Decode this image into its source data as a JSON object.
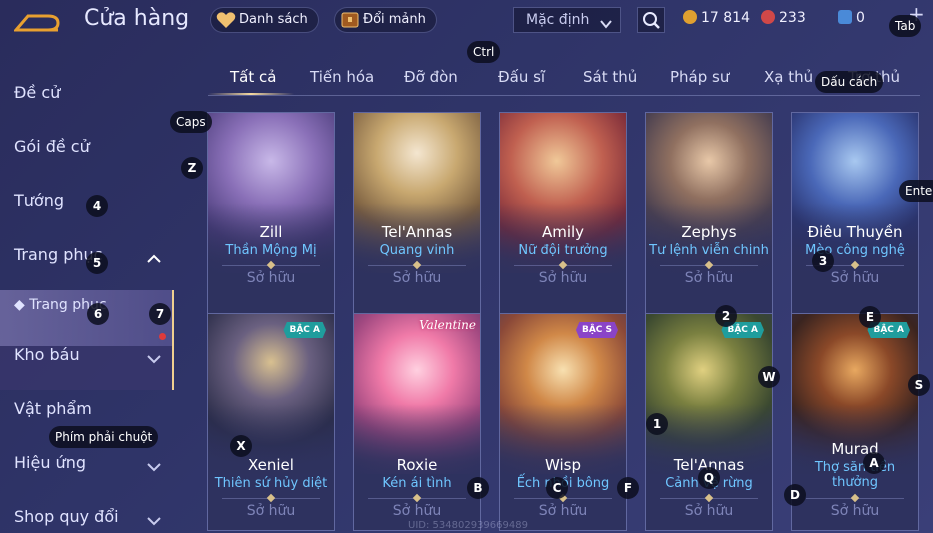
{
  "header": {
    "title": "Cửa hàng",
    "wishlist_label": "Danh sách",
    "exchange_label": "Đổi mảnh",
    "sort_value": "Mặc định",
    "currency_gold": "17 814",
    "currency_red": "233",
    "currency_voucher": "0",
    "plus_symbol": "+"
  },
  "tabs": [
    {
      "label": "Tất cả",
      "active": true
    },
    {
      "label": "Tiến hóa"
    },
    {
      "label": "Đỡ đòn"
    },
    {
      "label": "Đấu sĩ"
    },
    {
      "label": "Sát thủ"
    },
    {
      "label": "Pháp sư"
    },
    {
      "label": "Xạ thủ"
    },
    {
      "label": "Trợ thủ"
    }
  ],
  "sidebar": {
    "items": [
      {
        "label": "Đề cử"
      },
      {
        "label": "Gói đề cử"
      },
      {
        "label": "Tướng"
      },
      {
        "label": "Trang phục",
        "expanded": true
      },
      {
        "label": "◆ Trang phục"
      },
      {
        "label": "Kho báu"
      },
      {
        "label": "Vật phẩm"
      },
      {
        "label": "Hiệu ứng"
      },
      {
        "label": "Shop quy đổi"
      }
    ]
  },
  "cards": [
    {
      "hero": "Zill",
      "skin": "Thần Mộng Mị",
      "status": "Sở hữu"
    },
    {
      "hero": "Tel'Annas",
      "skin": "Quang vinh",
      "status": "Sở hữu"
    },
    {
      "hero": "Amily",
      "skin": "Nữ đội trưởng",
      "status": "Sở hữu"
    },
    {
      "hero": "Zephys",
      "skin": "Tư lệnh viễn chinh",
      "status": "Sở hữu"
    },
    {
      "hero": "Điêu Thuyền",
      "skin": "Mèo công nghệ",
      "status": "Sở hữu"
    },
    {
      "hero": "Xeniel",
      "skin": "Thiên sứ hủy diệt",
      "status": "Sở hữu",
      "rank": "BẬC A"
    },
    {
      "hero": "Roxie",
      "skin": "Kén ái tình",
      "status": "Sở hữu",
      "logo_text": "Valentine"
    },
    {
      "hero": "Wisp",
      "skin": "Ếch nhồi bông",
      "status": "Sở hữu",
      "rank": "BẬC S"
    },
    {
      "hero": "Tel'Annas",
      "skin": "Cảnh vệ rừng",
      "status": "Sở hữu",
      "rank": "BẬC A"
    },
    {
      "hero": "Murad",
      "skin": "Thợ săn tiền thưởng",
      "status": "Sở hữu",
      "rank": "BẬC A"
    }
  ],
  "footer": {
    "uid": "UID: 534802939669489"
  },
  "key_hints": {
    "tab": "Tab",
    "ctrl": "Ctrl",
    "space": "Dấu cách",
    "caps": "Caps",
    "enter": "Enter",
    "right_click": "Phím phải chuột",
    "z": "Z",
    "four": "4",
    "five": "5",
    "six": "6",
    "seven": "7",
    "three": "3",
    "two": "2",
    "e": "E",
    "w": "W",
    "s": "S",
    "one": "1",
    "x": "X",
    "b": "B",
    "c": "C",
    "f": "F",
    "q": "Q",
    "a": "A",
    "d": "D"
  },
  "colors": {
    "accent": "#f0d090",
    "skin_text": "#6fc6ff",
    "owned_text": "#7e84b8",
    "background": "#2f3468"
  }
}
